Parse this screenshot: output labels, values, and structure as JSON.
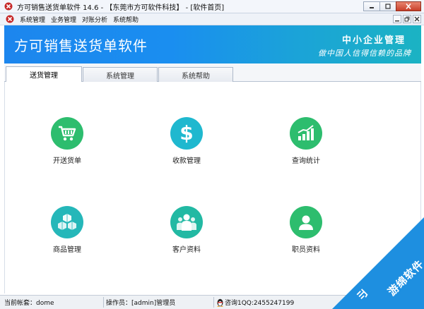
{
  "window": {
    "title": "方可销售送货单软件 14.6 - 【东莞市方可软件科技】 - [软件首页]"
  },
  "menubar": {
    "items": [
      "系统管理",
      "业务管理",
      "对账分析",
      "系统帮助"
    ]
  },
  "banner": {
    "title": "方可销售送货单软件",
    "right_line1": "中小企业管理",
    "right_line2": "做中国人信得信赖的品牌"
  },
  "tabs": [
    {
      "label": "送货管理",
      "active": true
    },
    {
      "label": "系统管理",
      "active": false
    },
    {
      "label": "系统帮助",
      "active": false
    }
  ],
  "tiles": [
    {
      "label": "开送货单",
      "icon": "shopping-cart-icon",
      "color": "#2dbd6e"
    },
    {
      "label": "收款管理",
      "icon": "dollar-icon",
      "color": "#1fb8cf"
    },
    {
      "label": "查询统计",
      "icon": "bar-chart-icon",
      "color": "#2dbd6e"
    },
    {
      "label": "商品管理",
      "icon": "cubes-icon",
      "color": "#25b7b9"
    },
    {
      "label": "客户资料",
      "icon": "customers-icon",
      "color": "#22b9a3"
    },
    {
      "label": "职员资料",
      "icon": "employee-icon",
      "color": "#2dbd6e"
    }
  ],
  "status": {
    "account": "当前帐套：dome",
    "operator": "操作员：[admin]管理员",
    "contact": "咨询1QQ:2455247199"
  },
  "watermark": {
    "text": "游绵软件"
  }
}
